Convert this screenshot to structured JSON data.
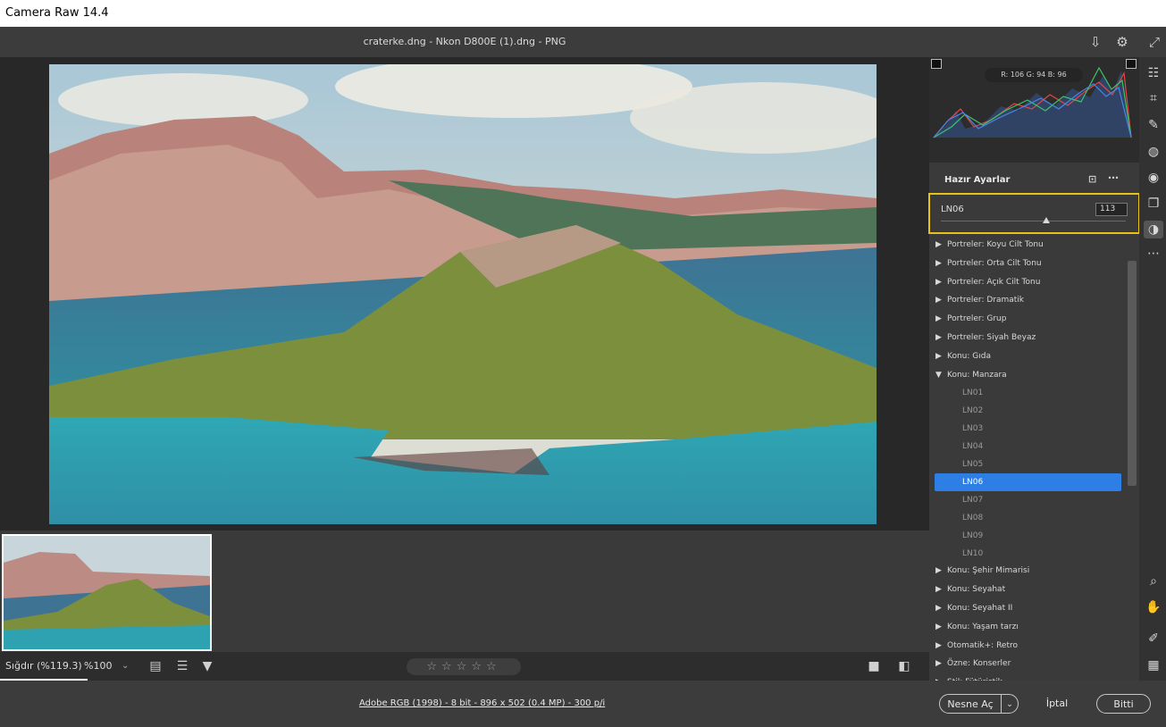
{
  "window": {
    "title": "Camera Raw 14.4"
  },
  "document": {
    "filename": "craterke.dng - Nkon D800E (1).dng  -  PNG"
  },
  "histogram": {
    "rgb_readout": "R: 106   G: 94   B: 96"
  },
  "presets": {
    "header": "Hazır Ayarlar",
    "selected_name": "LN06",
    "amount_value": "113",
    "amount_fraction": 0.57,
    "items": [
      {
        "label": "Portreler: Koyu Cilt Tonu",
        "type": "group",
        "expanded": false
      },
      {
        "label": "Portreler: Orta Cilt Tonu",
        "type": "group",
        "expanded": false
      },
      {
        "label": "Portreler: Açık Cilt Tonu",
        "type": "group",
        "expanded": false
      },
      {
        "label": "Portreler: Dramatik",
        "type": "group",
        "expanded": false
      },
      {
        "label": "Portreler: Grup",
        "type": "group",
        "expanded": false
      },
      {
        "label": "Portreler: Siyah Beyaz",
        "type": "group",
        "expanded": false
      },
      {
        "label": "Konu: Gıda",
        "type": "group",
        "expanded": false
      },
      {
        "label": "Konu: Manzara",
        "type": "group",
        "expanded": true
      },
      {
        "label": "LN01",
        "type": "child"
      },
      {
        "label": "LN02",
        "type": "child"
      },
      {
        "label": "LN03",
        "type": "child"
      },
      {
        "label": "LN04",
        "type": "child"
      },
      {
        "label": "LN05",
        "type": "child"
      },
      {
        "label": "LN06",
        "type": "child",
        "selected": true
      },
      {
        "label": "LN07",
        "type": "child"
      },
      {
        "label": "LN08",
        "type": "child"
      },
      {
        "label": "LN09",
        "type": "child"
      },
      {
        "label": "LN10",
        "type": "child"
      },
      {
        "label": "Konu: Şehir Mimarisi",
        "type": "group",
        "expanded": false
      },
      {
        "label": "Konu: Seyahat",
        "type": "group",
        "expanded": false
      },
      {
        "label": "Konu: Seyahat II",
        "type": "group",
        "expanded": false
      },
      {
        "label": "Konu: Yaşam tarzı",
        "type": "group",
        "expanded": false
      },
      {
        "label": "Otomatik+: Retro",
        "type": "group",
        "expanded": false
      },
      {
        "label": "Özne: Konserler",
        "type": "group",
        "expanded": false
      },
      {
        "label": "Stil: Fütüristik",
        "type": "group",
        "expanded": false
      }
    ]
  },
  "bottombar": {
    "zoom_fit": "Sığdır (%119.3)",
    "zoom_100": "%100",
    "stars": "☆☆☆☆☆"
  },
  "footer": {
    "workflow_link": "Adobe RGB (1998) - 8 bit - 896 x 502 (0.4 MP) - 300 p/i",
    "open_button": "Nesne Aç",
    "cancel_button": "İptal",
    "done_button": "Bitti"
  },
  "colors": {
    "selection": "#2d7fe6",
    "highlight_border": "#e6c21a"
  }
}
